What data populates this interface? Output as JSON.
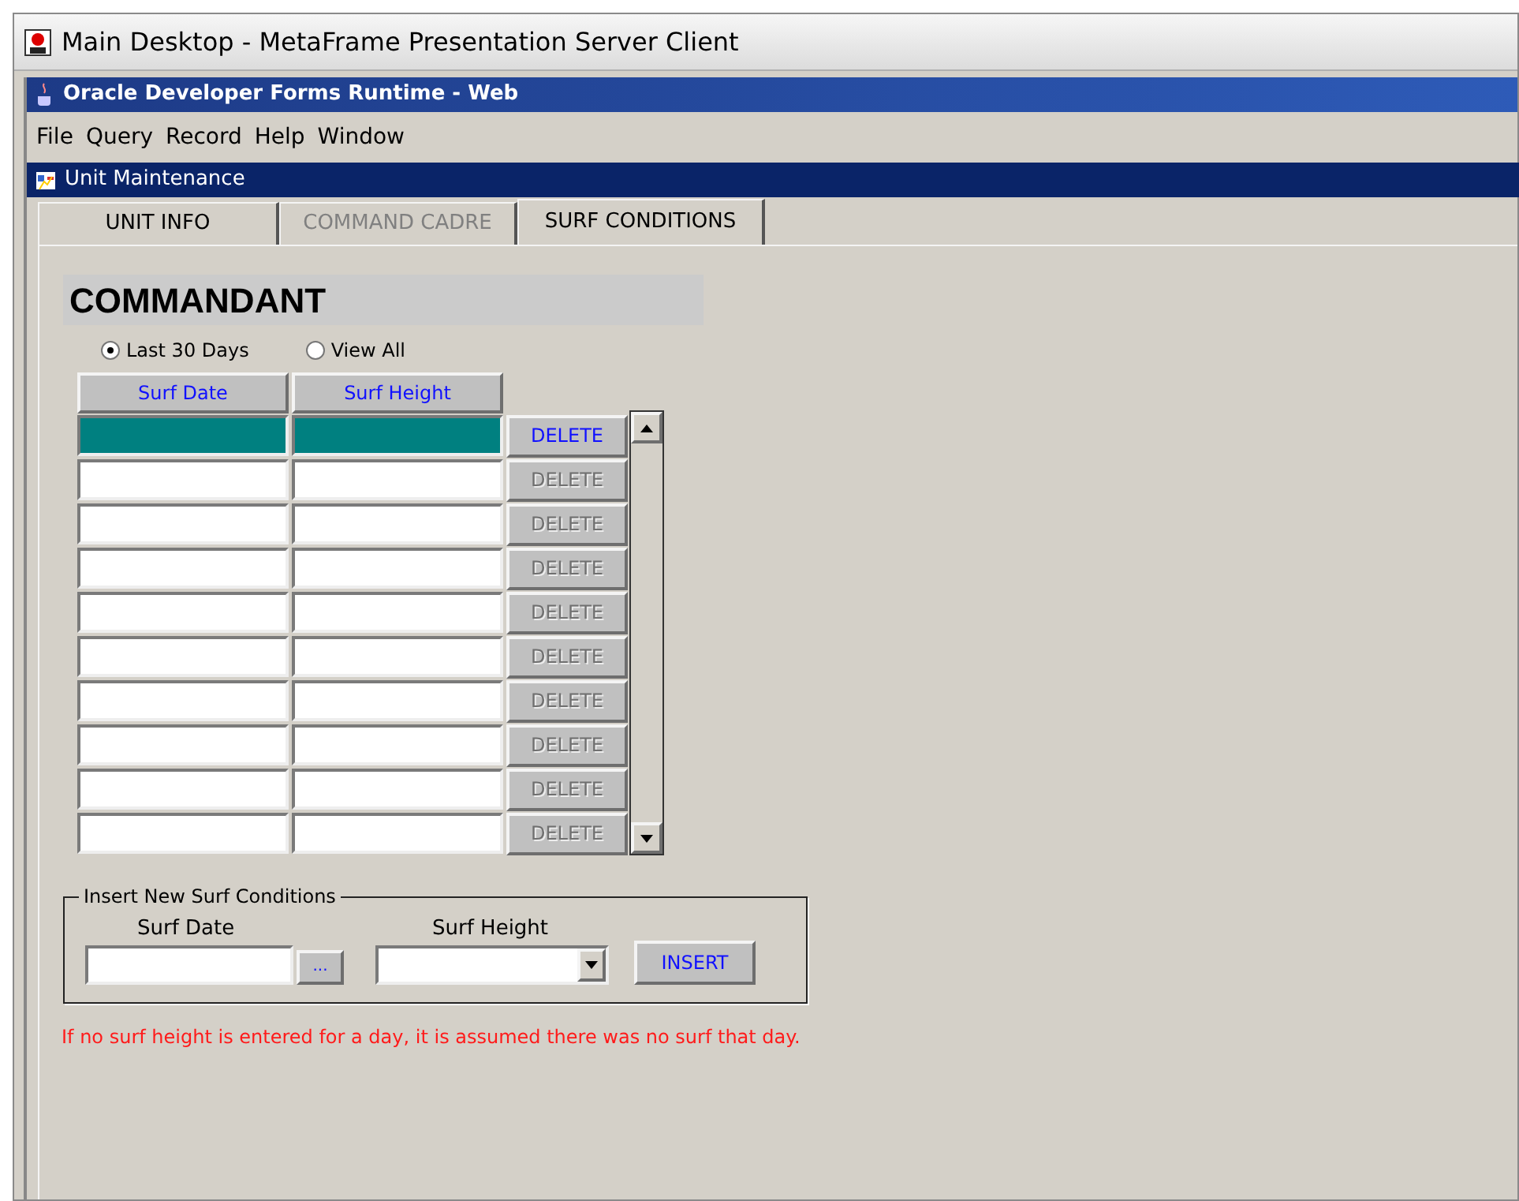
{
  "window": {
    "title": "Main Desktop - MetaFrame Presentation Server Client"
  },
  "app_window": {
    "title": "Oracle Developer Forms Runtime - Web"
  },
  "menu": [
    {
      "label": "File"
    },
    {
      "label": "Query"
    },
    {
      "label": "Record"
    },
    {
      "label": "Help"
    },
    {
      "label": "Window"
    }
  ],
  "form_window": {
    "title": "Unit Maintenance"
  },
  "tabs": [
    {
      "label": "UNIT INFO",
      "selected": false,
      "disabled": false
    },
    {
      "label": "COMMAND CADRE",
      "selected": false,
      "disabled": true
    },
    {
      "label": "SURF CONDITIONS",
      "selected": true,
      "disabled": false
    }
  ],
  "heading": "COMMANDANT",
  "filter": [
    {
      "label": "Last 30 Days",
      "selected": true
    },
    {
      "label": "View All",
      "selected": false
    }
  ],
  "table": {
    "columns": [
      "Surf Date",
      "Surf Height"
    ],
    "rows": [
      {
        "selected": true,
        "delete": {
          "label": "DELETE",
          "disabled": false
        }
      },
      {
        "selected": false,
        "delete": {
          "label": "DELETE",
          "disabled": true
        }
      },
      {
        "selected": false,
        "delete": {
          "label": "DELETE",
          "disabled": true
        }
      },
      {
        "selected": false,
        "delete": {
          "label": "DELETE",
          "disabled": true
        }
      },
      {
        "selected": false,
        "delete": {
          "label": "DELETE",
          "disabled": true
        }
      },
      {
        "selected": false,
        "delete": {
          "label": "DELETE",
          "disabled": true
        }
      },
      {
        "selected": false,
        "delete": {
          "label": "DELETE",
          "disabled": true
        }
      },
      {
        "selected": false,
        "delete": {
          "label": "DELETE",
          "disabled": true
        }
      },
      {
        "selected": false,
        "delete": {
          "label": "DELETE",
          "disabled": true
        }
      },
      {
        "selected": false,
        "delete": {
          "label": "DELETE",
          "disabled": true
        }
      }
    ]
  },
  "insert_group": {
    "title": "Insert New Surf Conditions",
    "date_label": "Surf Date",
    "date_button": "...",
    "height_label": "Surf Height",
    "insert_button": "INSERT"
  },
  "note": "If no surf height is entered for a day, it is assumed there was no surf that day."
}
